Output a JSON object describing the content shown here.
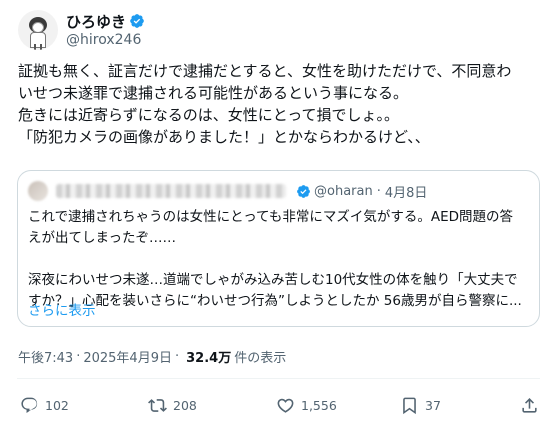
{
  "author": {
    "display_name": "ひろゆき",
    "handle": "@hirox246"
  },
  "tweet": {
    "lines": [
      "証拠も無く、証言だけで逮捕だとすると、女性を助けただけで、不同意わ",
      "いせつ未遂罪で逮捕される可能性があるという事になる。",
      "危きには近寄らずになるのは、女性にとって損でしょ。。",
      "「防犯カメラの画像がありました！」とかならわかるけど、、"
    ]
  },
  "quote": {
    "handle": "@oharan",
    "date": "4月8日",
    "lines_1": [
      "これで逮捕されちゃうのは女性にとっても非常にマズイ気がする。AED問題の答",
      "えが出てしまったぞ……"
    ],
    "lines_2": [
      "深夜にわいせつ未遂…道端でしゃがみ込み苦しむ10代女性の体を触り「大丈夫で",
      "すか？」心配を装いさらに“わいせつ行為”しようとしたか 56歳男が自ら警察に..."
    ],
    "show_more": "さらに表示"
  },
  "meta": {
    "time": "午後7:43",
    "date": "2025年4月9日",
    "views": "32.4万",
    "views_label": "件の表示"
  },
  "actions": {
    "replies": "102",
    "reposts": "208",
    "likes": "1,556",
    "bookmarks": "37"
  },
  "colors": {
    "accent": "#1d9bf0",
    "secondary_text": "#536471",
    "repost_icon": "#17bf63"
  }
}
